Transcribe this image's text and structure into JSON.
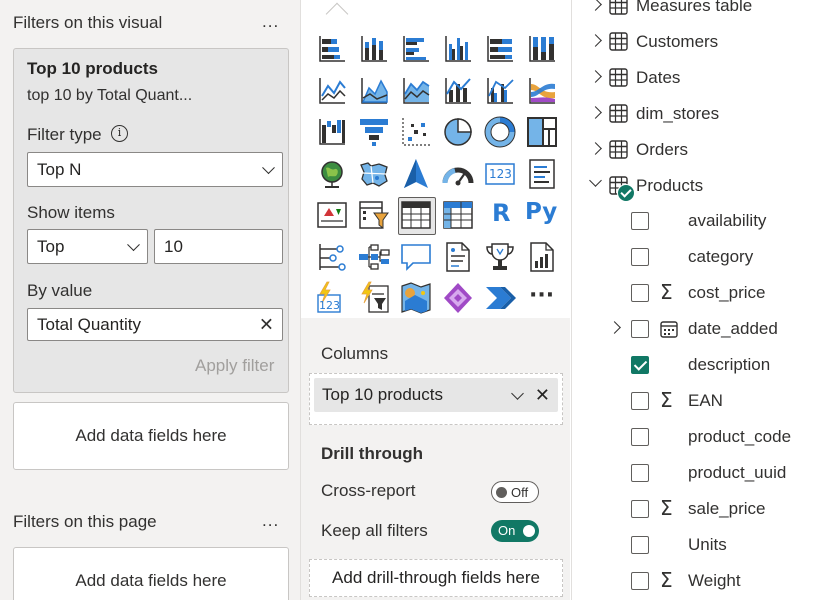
{
  "filters": {
    "visual_header": "Filters on this visual",
    "more": "...",
    "card": {
      "title": "Top 10 products",
      "subtitle": "top 10 by Total Quant...",
      "filter_type_label": "Filter type",
      "filter_type_value": "Top N",
      "show_items_label": "Show items",
      "show_items_direction": "Top",
      "show_items_count": "10",
      "by_value_label": "By value",
      "by_value_field": "Total Quantity",
      "apply_label": "Apply filter"
    },
    "add_fields_1": "Add data fields here",
    "page_header": "Filters on this page",
    "add_fields_2": "Add data fields here"
  },
  "viz": {
    "icons": [
      "stacked-bar-chart-icon",
      "stacked-column-chart-icon",
      "clustered-bar-chart-icon",
      "clustered-column-chart-icon",
      "100-stacked-bar-chart-icon",
      "100-stacked-column-chart-icon",
      "line-chart-icon",
      "area-chart-icon",
      "stacked-area-chart-icon",
      "line-and-stacked-column-chart-icon",
      "line-and-clustered-column-chart-icon",
      "ribbon-chart-icon",
      "waterfall-chart-icon",
      "funnel-chart-icon",
      "scatter-chart-icon",
      "pie-chart-icon",
      "donut-chart-icon",
      "treemap-icon",
      "map-icon",
      "filled-map-icon",
      "azure-map-icon",
      "gauge-icon",
      "card-icon",
      "multi-row-card-icon",
      "kpi-icon",
      "slicer-icon",
      "table-icon",
      "matrix-icon",
      "r-script-visual-icon",
      "python-visual-icon",
      "key-influencers-icon",
      "decomposition-tree-icon",
      "qa-icon",
      "smart-narrative-icon",
      "metrics-icon",
      "paginated-report-icon",
      "power-apps-icon",
      "power-automate-icon",
      "arcgis-map-icon",
      "power-apps-purple-icon",
      "power-automate-arrow-icon",
      "more-visuals-icon"
    ],
    "r_label": "R",
    "py_label": "Py",
    "card_label": "123",
    "more_label": "···",
    "columns_label": "Columns",
    "columns_field": "Top 10 products",
    "drill_header": "Drill through",
    "cross_report_label": "Cross-report",
    "cross_report_state": "Off",
    "keep_filters_label": "Keep all filters",
    "keep_filters_state": "On",
    "add_drill_label": "Add drill-through fields here"
  },
  "data": {
    "tables": [
      {
        "name": "Measures table",
        "expanded": false
      },
      {
        "name": "Customers",
        "expanded": false
      },
      {
        "name": "Dates",
        "expanded": false
      },
      {
        "name": "dim_stores",
        "expanded": false
      },
      {
        "name": "Orders",
        "expanded": false
      },
      {
        "name": "Products",
        "expanded": true
      }
    ],
    "fields": [
      {
        "name": "availability",
        "checked": false,
        "type": "text"
      },
      {
        "name": "category",
        "checked": false,
        "type": "text"
      },
      {
        "name": "cost_price",
        "checked": false,
        "type": "sum"
      },
      {
        "name": "date_added",
        "checked": false,
        "type": "date"
      },
      {
        "name": "description",
        "checked": true,
        "type": "text"
      },
      {
        "name": "EAN",
        "checked": false,
        "type": "sum"
      },
      {
        "name": "product_code",
        "checked": false,
        "type": "text"
      },
      {
        "name": "product_uuid",
        "checked": false,
        "type": "text"
      },
      {
        "name": "sale_price",
        "checked": false,
        "type": "sum"
      },
      {
        "name": "Units",
        "checked": false,
        "type": "text"
      },
      {
        "name": "Weight",
        "checked": false,
        "type": "sum"
      }
    ],
    "sigma": "Σ"
  },
  "colors": {
    "accent_green": "#117865",
    "viz_blue": "#2b7cd3",
    "viz_light_blue": "#74b4e8",
    "viz_dark": "#323130",
    "viz_yellow": "#f2c811",
    "viz_orange": "#e8a33d",
    "viz_purple": "#a04ac6"
  }
}
